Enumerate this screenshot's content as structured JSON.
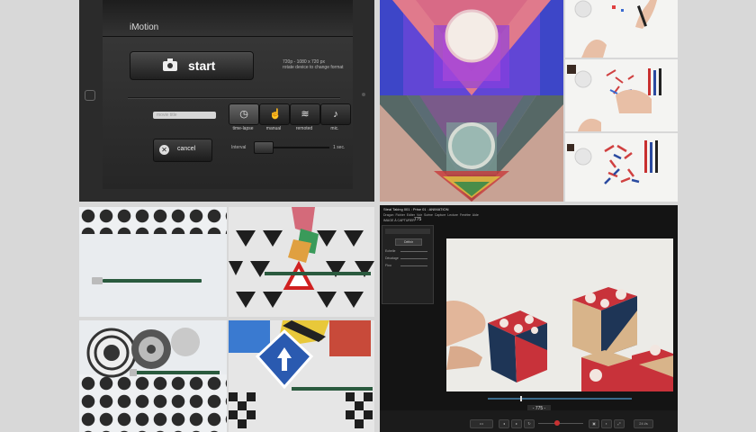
{
  "imotion": {
    "app_title": "iMotion",
    "start_label": "start",
    "resolution_lines": [
      "720p - 1080 x 720 px",
      "rotate device to change format"
    ],
    "movie_title_placeholder": "movie title",
    "modes": [
      {
        "label": "time-lapse",
        "icon": "stopwatch-icon",
        "glyph": "◷",
        "selected": true
      },
      {
        "label": "manual",
        "icon": "hand-pointer-icon",
        "glyph": "☝",
        "selected": false
      },
      {
        "label": "remoted",
        "icon": "wifi-icon",
        "glyph": "≋",
        "selected": false
      },
      {
        "label": "mic.",
        "icon": "microphone-icon",
        "glyph": "♪",
        "selected": false
      }
    ],
    "cancel_label": "cancel",
    "interval_label": "Interval",
    "interval_value": "1 sec.",
    "interval_slider_level": 0.0
  },
  "dragonframe": {
    "window_title": "Steal Taking 001 : Prise 01 : ANIMATION",
    "menu": [
      "Dragon",
      "Fichier",
      "Editer",
      "Voir",
      "Scène",
      "Capture",
      "Lecture",
      "Fenêtre",
      "Aide"
    ],
    "frame_label": "IMAGE À CAPTURER",
    "frame_number": "775",
    "timeline_counter": "- 775 -",
    "panel_button": "Définir",
    "panel_rows": [
      "Echelle",
      "Décalage",
      "Flou"
    ],
    "fps": "24 i/s",
    "colors": {
      "cube_red": "#c8323a",
      "cube_navy": "#1e3556",
      "cube_wood": "#d8b48a"
    }
  }
}
